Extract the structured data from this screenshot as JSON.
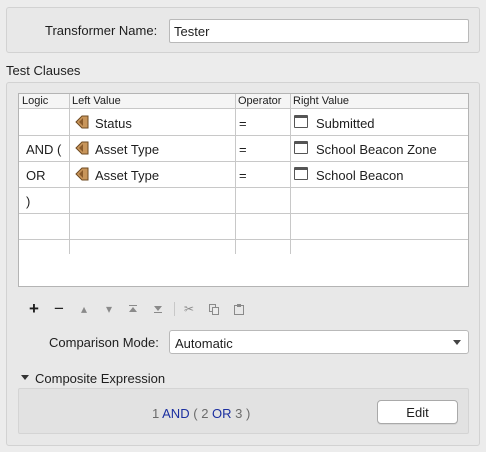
{
  "name_field": {
    "label": "Transformer Name:",
    "value": "Tester"
  },
  "test_clauses": {
    "title": "Test Clauses",
    "columns": [
      "Logic",
      "Left Value",
      "Operator",
      "Right Value"
    ],
    "rows": [
      {
        "logic": "",
        "left": "Status",
        "operator": "=",
        "right": "Submitted"
      },
      {
        "logic": "AND (",
        "left": "Asset Type",
        "operator": "=",
        "right": "School Beacon Zone"
      },
      {
        "logic": "OR",
        "left": "Asset Type",
        "operator": "=",
        "right": "School Beacon"
      },
      {
        "logic": ")",
        "left": "",
        "operator": "",
        "right": ""
      },
      {
        "logic": "",
        "left": "",
        "operator": "",
        "right": ""
      }
    ]
  },
  "toolbar": {
    "icons": [
      "plus-icon",
      "minus-icon",
      "move-up-icon",
      "move-down-icon",
      "move-top-icon",
      "move-bottom-icon",
      "cut-icon",
      "copy-icon",
      "paste-icon"
    ]
  },
  "comparison_mode": {
    "label": "Comparison Mode:",
    "value": "Automatic"
  },
  "composite": {
    "header": "Composite Expression",
    "expr": {
      "n1": "1",
      "and": "AND",
      "lp": "(",
      "n2": "2",
      "or": "OR",
      "n3": "3",
      "rp": ")"
    },
    "edit_label": "Edit"
  },
  "colors": {
    "keyword": "#1b2fa0",
    "number": "#6b6b6b",
    "attribute_icon": "#c8955a"
  }
}
